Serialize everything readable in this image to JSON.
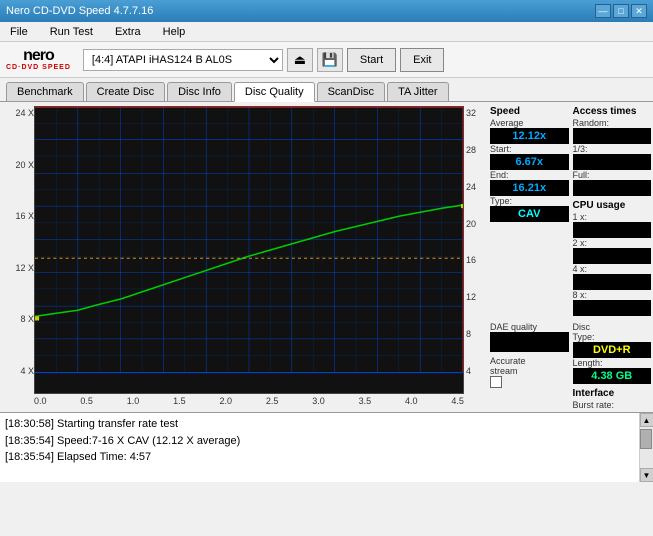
{
  "app": {
    "title": "Nero CD-DVD Speed 4.7.7.16",
    "window_buttons": [
      "—",
      "□",
      "✕"
    ]
  },
  "menu": {
    "items": [
      "File",
      "Run Test",
      "Extra",
      "Help"
    ]
  },
  "toolbar": {
    "logo": "nero",
    "logo_sub": "CD·DVD SPEED",
    "drive_value": "[4:4]  ATAPI iHAS124  B AL0S",
    "start_label": "Start",
    "exit_label": "Exit"
  },
  "tabs": [
    {
      "label": "Benchmark",
      "active": false
    },
    {
      "label": "Create Disc",
      "active": false
    },
    {
      "label": "Disc Info",
      "active": false
    },
    {
      "label": "Disc Quality",
      "active": true
    },
    {
      "label": "ScanDisc",
      "active": false
    },
    {
      "label": "TA Jitter",
      "active": false
    }
  ],
  "right_panel": {
    "speed_section_title": "Speed",
    "average_label": "Average",
    "average_value": "12.12x",
    "start_label": "Start:",
    "start_value": "6.67x",
    "end_label": "End:",
    "end_value": "16.21x",
    "type_label": "Type:",
    "type_value": "CAV",
    "access_times_title": "Access times",
    "random_label": "Random:",
    "random_value": "",
    "one_third_label": "1/3:",
    "one_third_value": "",
    "full_label": "Full:",
    "full_value": "",
    "cpu_label": "CPU usage",
    "cpu_1x_label": "1 x:",
    "cpu_1x_value": "",
    "cpu_2x_label": "2 x:",
    "cpu_2x_value": "",
    "cpu_4x_label": "4 x:",
    "cpu_4x_value": "",
    "cpu_8x_label": "8 x:",
    "cpu_8x_value": "",
    "dae_label": "DAE quality",
    "dae_value": "",
    "accurate_label": "Accurate",
    "stream_label": "stream",
    "disc_type_label": "Disc",
    "disc_type_label2": "Type:",
    "disc_type_value": "DVD+R",
    "disc_length_label": "Length:",
    "disc_length_value": "4.38 GB",
    "interface_title": "Interface",
    "burst_label": "Burst rate:"
  },
  "chart": {
    "y_left_labels": [
      "24 X",
      "20 X",
      "16 X",
      "12 X",
      "8 X",
      "4 X"
    ],
    "y_right_labels": [
      "32",
      "28",
      "24",
      "20",
      "16",
      "12",
      "8",
      "4"
    ],
    "x_labels": [
      "0.0",
      "0.5",
      "1.0",
      "1.5",
      "2.0",
      "2.5",
      "3.0",
      "3.5",
      "4.0",
      "4.5"
    ]
  },
  "log": {
    "lines": [
      "[18:30:58]  Starting transfer rate test",
      "[18:35:54]  Speed:7-16 X CAV (12.12 X average)",
      "[18:35:54]  Elapsed Time: 4:57"
    ]
  }
}
